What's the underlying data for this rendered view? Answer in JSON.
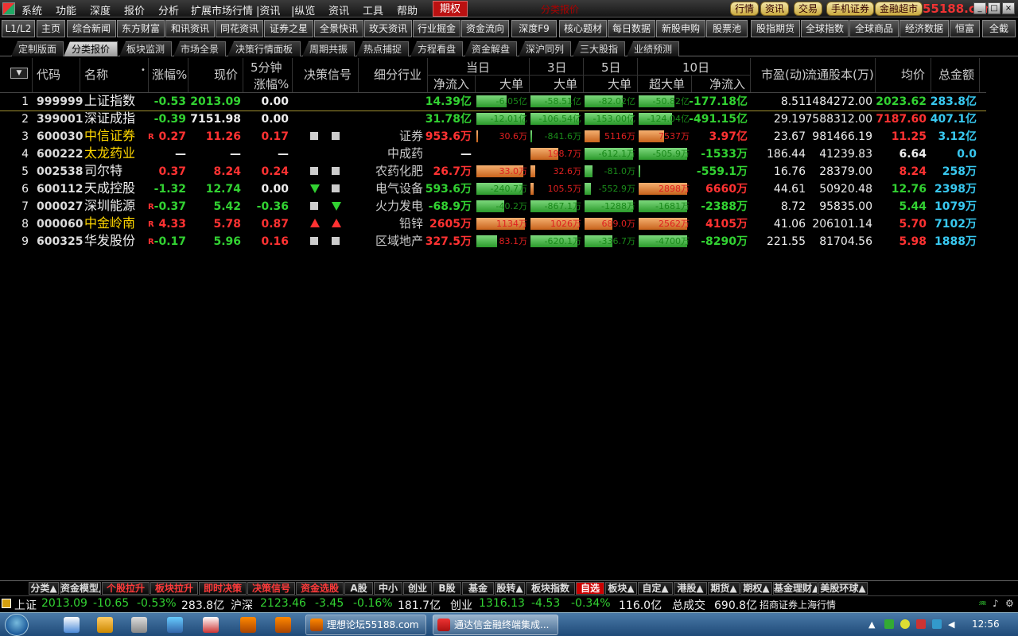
{
  "menubar": {
    "items": [
      "系统",
      "功能",
      "深度",
      "报价",
      "分析",
      "扩展市场行情",
      "|资讯",
      "|纵览",
      "资讯",
      "工具",
      "帮助",
      "期权"
    ],
    "title_ghost": "分类报价",
    "right_buttons": [
      "行情",
      "资讯",
      "交易",
      "手机证券",
      "金融超市",
      "迷你首页"
    ],
    "watermark": "55188.com"
  },
  "toolbar": {
    "items": [
      "L1/L2",
      "主页",
      "综合新闻",
      "东方财富",
      "和讯资讯",
      "同花资讯",
      "证券之星",
      "全景快讯",
      "玫天资讯",
      "行业掘金",
      "资金流向",
      "深度F9",
      "核心题材",
      "每日数据",
      "新股申购",
      "股票池",
      "股指期货",
      "全球指数",
      "全球商品",
      "经济数据",
      "恒富",
      "全截"
    ]
  },
  "tabs": [
    "定制版面",
    "分类报价",
    "板块监测",
    "市场全景",
    "决策行情面板",
    "周期共振",
    "热点捕捉",
    "方程看盘",
    "资金解盘",
    "深沪同列",
    "三大股指",
    "业绩预测"
  ],
  "table": {
    "headers": {
      "code": "代码",
      "name": "名称",
      "pct": "涨幅%",
      "price": "现价",
      "five_min_top": "5分钟",
      "five_min_bottom": "涨幅%",
      "signal": "决策信号",
      "industry": "细分行业",
      "today": "当日",
      "day3": "3日",
      "day5": "5日",
      "day10": "10日",
      "net_inflow": "净流入",
      "big_order": "大单",
      "super_big": "超大单",
      "pe": "市盈(动)",
      "float_shares": "流通股本(万)",
      "avg_price": "均价",
      "amount": "总金额"
    },
    "rows": [
      {
        "idx": "1",
        "code": "999999",
        "name": "上证指数",
        "r": "",
        "pct": "-0.53",
        "price": "2013.09",
        "m5": "0.00",
        "sig": [
          "",
          ""
        ],
        "ind": "",
        "net": "14.39亿",
        "b1": "-6.05亿",
        "b3": "-58.51亿",
        "b5": "-82.02亿",
        "s10": "-50.82亿",
        "n10": "-177.18亿",
        "pe": "8.51",
        "fs": "1484272.00",
        "avg": "2023.62",
        "amt": "283.8亿",
        "w1": 0.6,
        "c1": "g",
        "w3": 0.8,
        "c3": "g",
        "w5": 0.75,
        "c5": "g",
        "w10": 0.7,
        "c10": "g",
        "cpct": "down",
        "cprice": "down",
        "cm5": "flat",
        "cnet": "down",
        "cn10": "down",
        "cavg": "down",
        "cname": "white"
      },
      {
        "idx": "2",
        "code": "399001",
        "name": "深证成指",
        "r": "",
        "pct": "-0.39",
        "price": "7151.98",
        "m5": "0.00",
        "sig": [
          "",
          ""
        ],
        "ind": "",
        "net": "31.78亿",
        "b1": "-12.01亿",
        "b3": "-106.54亿",
        "b5": "-153.00亿",
        "s10": "-124.04亿",
        "n10": "-491.15亿",
        "pe": "29.19",
        "fs": "7588312.00",
        "avg": "7187.60",
        "amt": "407.1亿",
        "w1": 0.95,
        "c1": "g",
        "w3": 0.95,
        "c3": "g",
        "w5": 0.95,
        "c5": "g",
        "w10": 0.65,
        "c10": "g",
        "cpct": "down",
        "cprice": "flat",
        "cm5": "flat",
        "cnet": "down",
        "cn10": "down",
        "cavg": "up",
        "cname": "white"
      },
      {
        "idx": "3",
        "code": "600030",
        "name": "中信证券",
        "r": "R",
        "pct": "0.27",
        "price": "11.26",
        "m5": "0.17",
        "sig": [
          "sq",
          "sq"
        ],
        "ind": "证券",
        "net": "953.6万",
        "b1": "30.6万",
        "b3": "-841.6万",
        "b5": "5116万",
        "s10": "7537万",
        "n10": "3.97亿",
        "pe": "23.67",
        "fs": "981466.19",
        "avg": "11.25",
        "amt": "3.12亿",
        "w1": 0.03,
        "c1": "o",
        "w3": 0.03,
        "c3": "g",
        "w5": 0.3,
        "c5": "o",
        "w10": 0.5,
        "c10": "o",
        "cpct": "up",
        "cprice": "up",
        "cm5": "up",
        "cnet": "up",
        "cn10": "up",
        "cavg": "up",
        "cname": "yel"
      },
      {
        "idx": "4",
        "code": "600222",
        "name": "太龙药业",
        "r": "",
        "pct": "—",
        "price": "—",
        "m5": "—",
        "sig": [
          "",
          ""
        ],
        "ind": "中成药",
        "net": "—",
        "b1": "",
        "b3": "198.7万",
        "b5": "-612.1万",
        "s10": "-505.9万",
        "n10": "-1533万",
        "pe": "186.44",
        "fs": "41239.83",
        "avg": "6.64",
        "amt": "0.0",
        "w1": 0,
        "c1": "g",
        "w3": 0.55,
        "c3": "o",
        "w5": 0.95,
        "c5": "g",
        "w10": 0.95,
        "c10": "g",
        "cpct": "flat",
        "cprice": "flat",
        "cm5": "flat",
        "cnet": "flat",
        "cn10": "down",
        "cavg": "white",
        "cname": "yel"
      },
      {
        "idx": "5",
        "code": "002538",
        "name": "司尔特",
        "r": "",
        "pct": "0.37",
        "price": "8.24",
        "m5": "0.24",
        "sig": [
          "sq",
          "sq"
        ],
        "ind": "农药化肥",
        "net": "26.7万",
        "b1": "33.0万",
        "b3": "32.6万",
        "b5": "-81.0万",
        "s10": "",
        "n10": "-559.1万",
        "pe": "16.76",
        "fs": "28379.00",
        "avg": "8.24",
        "amt": "258万",
        "w1": 0.92,
        "c1": "o",
        "w3": 0.1,
        "c3": "o",
        "w5": 0.15,
        "c5": "g",
        "w10": 0.03,
        "c10": "g",
        "cpct": "up",
        "cprice": "up",
        "cm5": "up",
        "cnet": "up",
        "cn10": "down",
        "cavg": "up",
        "cname": "white"
      },
      {
        "idx": "6",
        "code": "600112",
        "name": "天成控股",
        "r": "",
        "pct": "-1.32",
        "price": "12.74",
        "m5": "0.00",
        "sig": [
          "down",
          "sq"
        ],
        "ind": "电气设备",
        "net": "593.6万",
        "b1": "-240.7万",
        "b3": "105.5万",
        "b5": "-552.9万",
        "s10": "2898万",
        "n10": "6660万",
        "pe": "44.61",
        "fs": "50920.48",
        "avg": "12.76",
        "amt": "2398万",
        "w1": 0.9,
        "c1": "g",
        "w3": 0.06,
        "c3": "o",
        "w5": 0.12,
        "c5": "g",
        "w10": 0.95,
        "c10": "o",
        "cpct": "down",
        "cprice": "down",
        "cm5": "flat",
        "cnet": "down",
        "cn10": "up",
        "cavg": "down",
        "cname": "white"
      },
      {
        "idx": "7",
        "code": "000027",
        "name": "深圳能源",
        "r": "R",
        "pct": "-0.37",
        "price": "5.42",
        "m5": "-0.36",
        "sig": [
          "sq",
          "down"
        ],
        "ind": "火力发电",
        "net": "-68.9万",
        "b1": "-40.2万",
        "b3": "-867.1万",
        "b5": "-1288万",
        "s10": "-1681万",
        "n10": "-2388万",
        "pe": "8.72",
        "fs": "95835.00",
        "avg": "5.44",
        "amt": "1079万",
        "w1": 0.55,
        "c1": "g",
        "w3": 0.9,
        "c3": "g",
        "w5": 0.95,
        "c5": "g",
        "w10": 0.95,
        "c10": "g",
        "cpct": "down",
        "cprice": "down",
        "cm5": "down",
        "cnet": "down",
        "cn10": "down",
        "cavg": "down",
        "cname": "white"
      },
      {
        "idx": "8",
        "code": "000060",
        "name": "中金岭南",
        "r": "R",
        "pct": "4.33",
        "price": "5.78",
        "m5": "0.87",
        "sig": [
          "up",
          "up"
        ],
        "ind": "铅锌",
        "net": "2605万",
        "b1": "1134万",
        "b3": "1026万",
        "b5": "689.0万",
        "s10": "2562万",
        "n10": "4105万",
        "pe": "41.06",
        "fs": "206101.14",
        "avg": "5.70",
        "amt": "7102万",
        "w1": 0.95,
        "c1": "o",
        "w3": 0.95,
        "c3": "o",
        "w5": 0.55,
        "c5": "o",
        "w10": 0.95,
        "c10": "o",
        "cpct": "up",
        "cprice": "up",
        "cm5": "up",
        "cnet": "up",
        "cn10": "up",
        "cavg": "up",
        "cname": "yel"
      },
      {
        "idx": "9",
        "code": "600325",
        "name": "华发股份",
        "r": "R",
        "pct": "-0.17",
        "price": "5.96",
        "m5": "0.16",
        "sig": [
          "sq",
          "sq"
        ],
        "ind": "区域地产",
        "net": "327.5万",
        "b1": "83.1万",
        "b3": "-620.1万",
        "b5": "-336.7万",
        "s10": "-4700万",
        "n10": "-8290万",
        "pe": "221.55",
        "fs": "81704.56",
        "avg": "5.98",
        "amt": "1888万",
        "w1": 0.4,
        "c1": "g",
        "w3": 0.92,
        "c3": "g",
        "w5": 0.55,
        "c5": "g",
        "w10": 0.95,
        "c10": "g",
        "cpct": "down",
        "cprice": "down",
        "cm5": "up",
        "cnet": "up",
        "cn10": "down",
        "cavg": "up",
        "cname": "white"
      }
    ]
  },
  "bottom_tabs": [
    "分类▲",
    "资金模型▲",
    "个股拉升",
    "板块拉升",
    "即时决策",
    "决策信号",
    "资金选股",
    "A股",
    "中小",
    "创业",
    "B股",
    "基金",
    "股转▲",
    "板块指数",
    "自选",
    "板块▲",
    "自定▲",
    "港股▲",
    "期货▲",
    "期权▲",
    "基金理财▲",
    "美股环球▲"
  ],
  "statusbar": {
    "sh_label": "上证",
    "sh_val": "2013.09",
    "sh_chg": "-10.65",
    "sh_pct": "-0.53%",
    "sh_amt": "283.8亿",
    "hs_label": "沪深",
    "hs_val": "2123.46",
    "hs_chg": "-3.45",
    "hs_pct": "-0.16%",
    "hs_amt": "181.7亿",
    "cy_label": "创业",
    "cy_val": "1316.13",
    "cy_chg": "-4.53",
    "cy_pct": "-0.34%",
    "cy_amt": "116.0亿",
    "total_label": "总成交",
    "total_amt": "690.8亿",
    "broker": "招商证券上海行情"
  },
  "taskbar": {
    "windows": [
      "理想论坛55188.com",
      "通达信金融终端集成..."
    ],
    "clock": "12:56"
  },
  "colors": {
    "up": "#ff3232",
    "down": "#32d232",
    "name_highlight": "#ffd700",
    "amount": "#38c8f0",
    "active_tab": "#c00"
  }
}
